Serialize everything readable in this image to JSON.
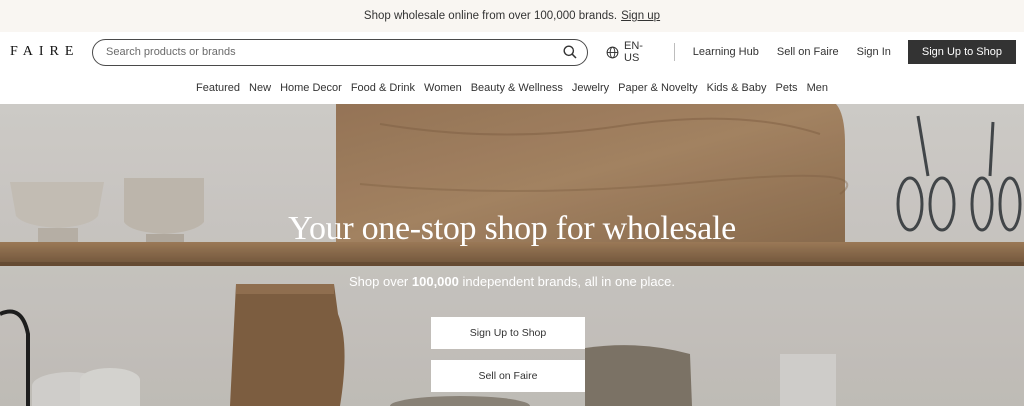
{
  "promo": {
    "text": "Shop wholesale online from over 100,000 brands.",
    "link": "Sign up"
  },
  "header": {
    "logo": "FAIRE",
    "search_placeholder": "Search products or brands",
    "language": "EN-US",
    "links": [
      "Learning Hub",
      "Sell on Faire",
      "Sign In"
    ],
    "cta": "Sign Up to Shop"
  },
  "categories": [
    "Featured",
    "New",
    "Home Decor",
    "Food & Drink",
    "Women",
    "Beauty & Wellness",
    "Jewelry",
    "Paper & Novelty",
    "Kids & Baby",
    "Pets",
    "Men"
  ],
  "hero": {
    "title": "Your one-stop shop for wholesale",
    "subtitle_pre": "Shop over ",
    "subtitle_bold": "100,000",
    "subtitle_post": " independent brands, all in one place.",
    "primary_button": "Sign Up to Shop",
    "secondary_button": "Sell on Faire"
  },
  "icons": {
    "search": "search-icon",
    "language": "globe-icon"
  },
  "colors": {
    "promo_bg": "#f9f6f2",
    "dark_button": "#333333",
    "text": "#333333"
  }
}
